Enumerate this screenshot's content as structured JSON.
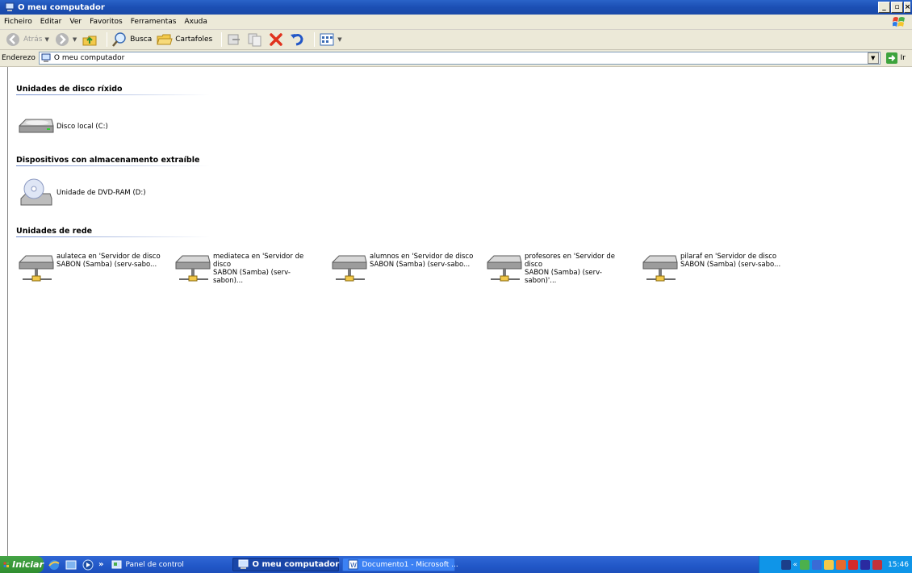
{
  "window": {
    "title": "O meu computador"
  },
  "menu": [
    "Ficheiro",
    "Editar",
    "Ver",
    "Favoritos",
    "Ferramentas",
    "Axuda"
  ],
  "toolbar": {
    "back_label": "Atrás",
    "search_label": "Busca",
    "folders_label": "Cartafoles"
  },
  "address": {
    "label": "Enderezo",
    "value": "O meu computador",
    "go_label": "Ir"
  },
  "groups": {
    "hard_disks": {
      "title": "Unidades de disco ríxido",
      "items": [
        {
          "label": "Disco local (C:)"
        }
      ]
    },
    "removable": {
      "title": "Dispositivos con almacenamento extraíble",
      "items": [
        {
          "label": "Unidade de DVD-RAM (D:)"
        }
      ]
    },
    "network": {
      "title": "Unidades de rede",
      "items": [
        {
          "line1": "aulateca en 'Servidor de disco",
          "line2": "SABON (Samba) (serv-sabo..."
        },
        {
          "line1": "mediateca en 'Servidor de disco",
          "line2": "SABON (Samba) (serv-sabon)..."
        },
        {
          "line1": "alumnos en 'Servidor de disco",
          "line2": "SABON (Samba) (serv-sabo..."
        },
        {
          "line1": "profesores en 'Servidor de disco",
          "line2": "SABON (Samba) (serv-sabon)'..."
        },
        {
          "line1": "pilaraf en 'Servidor de disco",
          "line2": "SABON (Samba) (serv-sabo..."
        }
      ]
    }
  },
  "taskbar": {
    "start_label": "Iniciar",
    "panel_label": "Panel de control",
    "tasks": [
      "O meu computador",
      "Documento1 - Microsoft ..."
    ],
    "clock": "15:46"
  }
}
